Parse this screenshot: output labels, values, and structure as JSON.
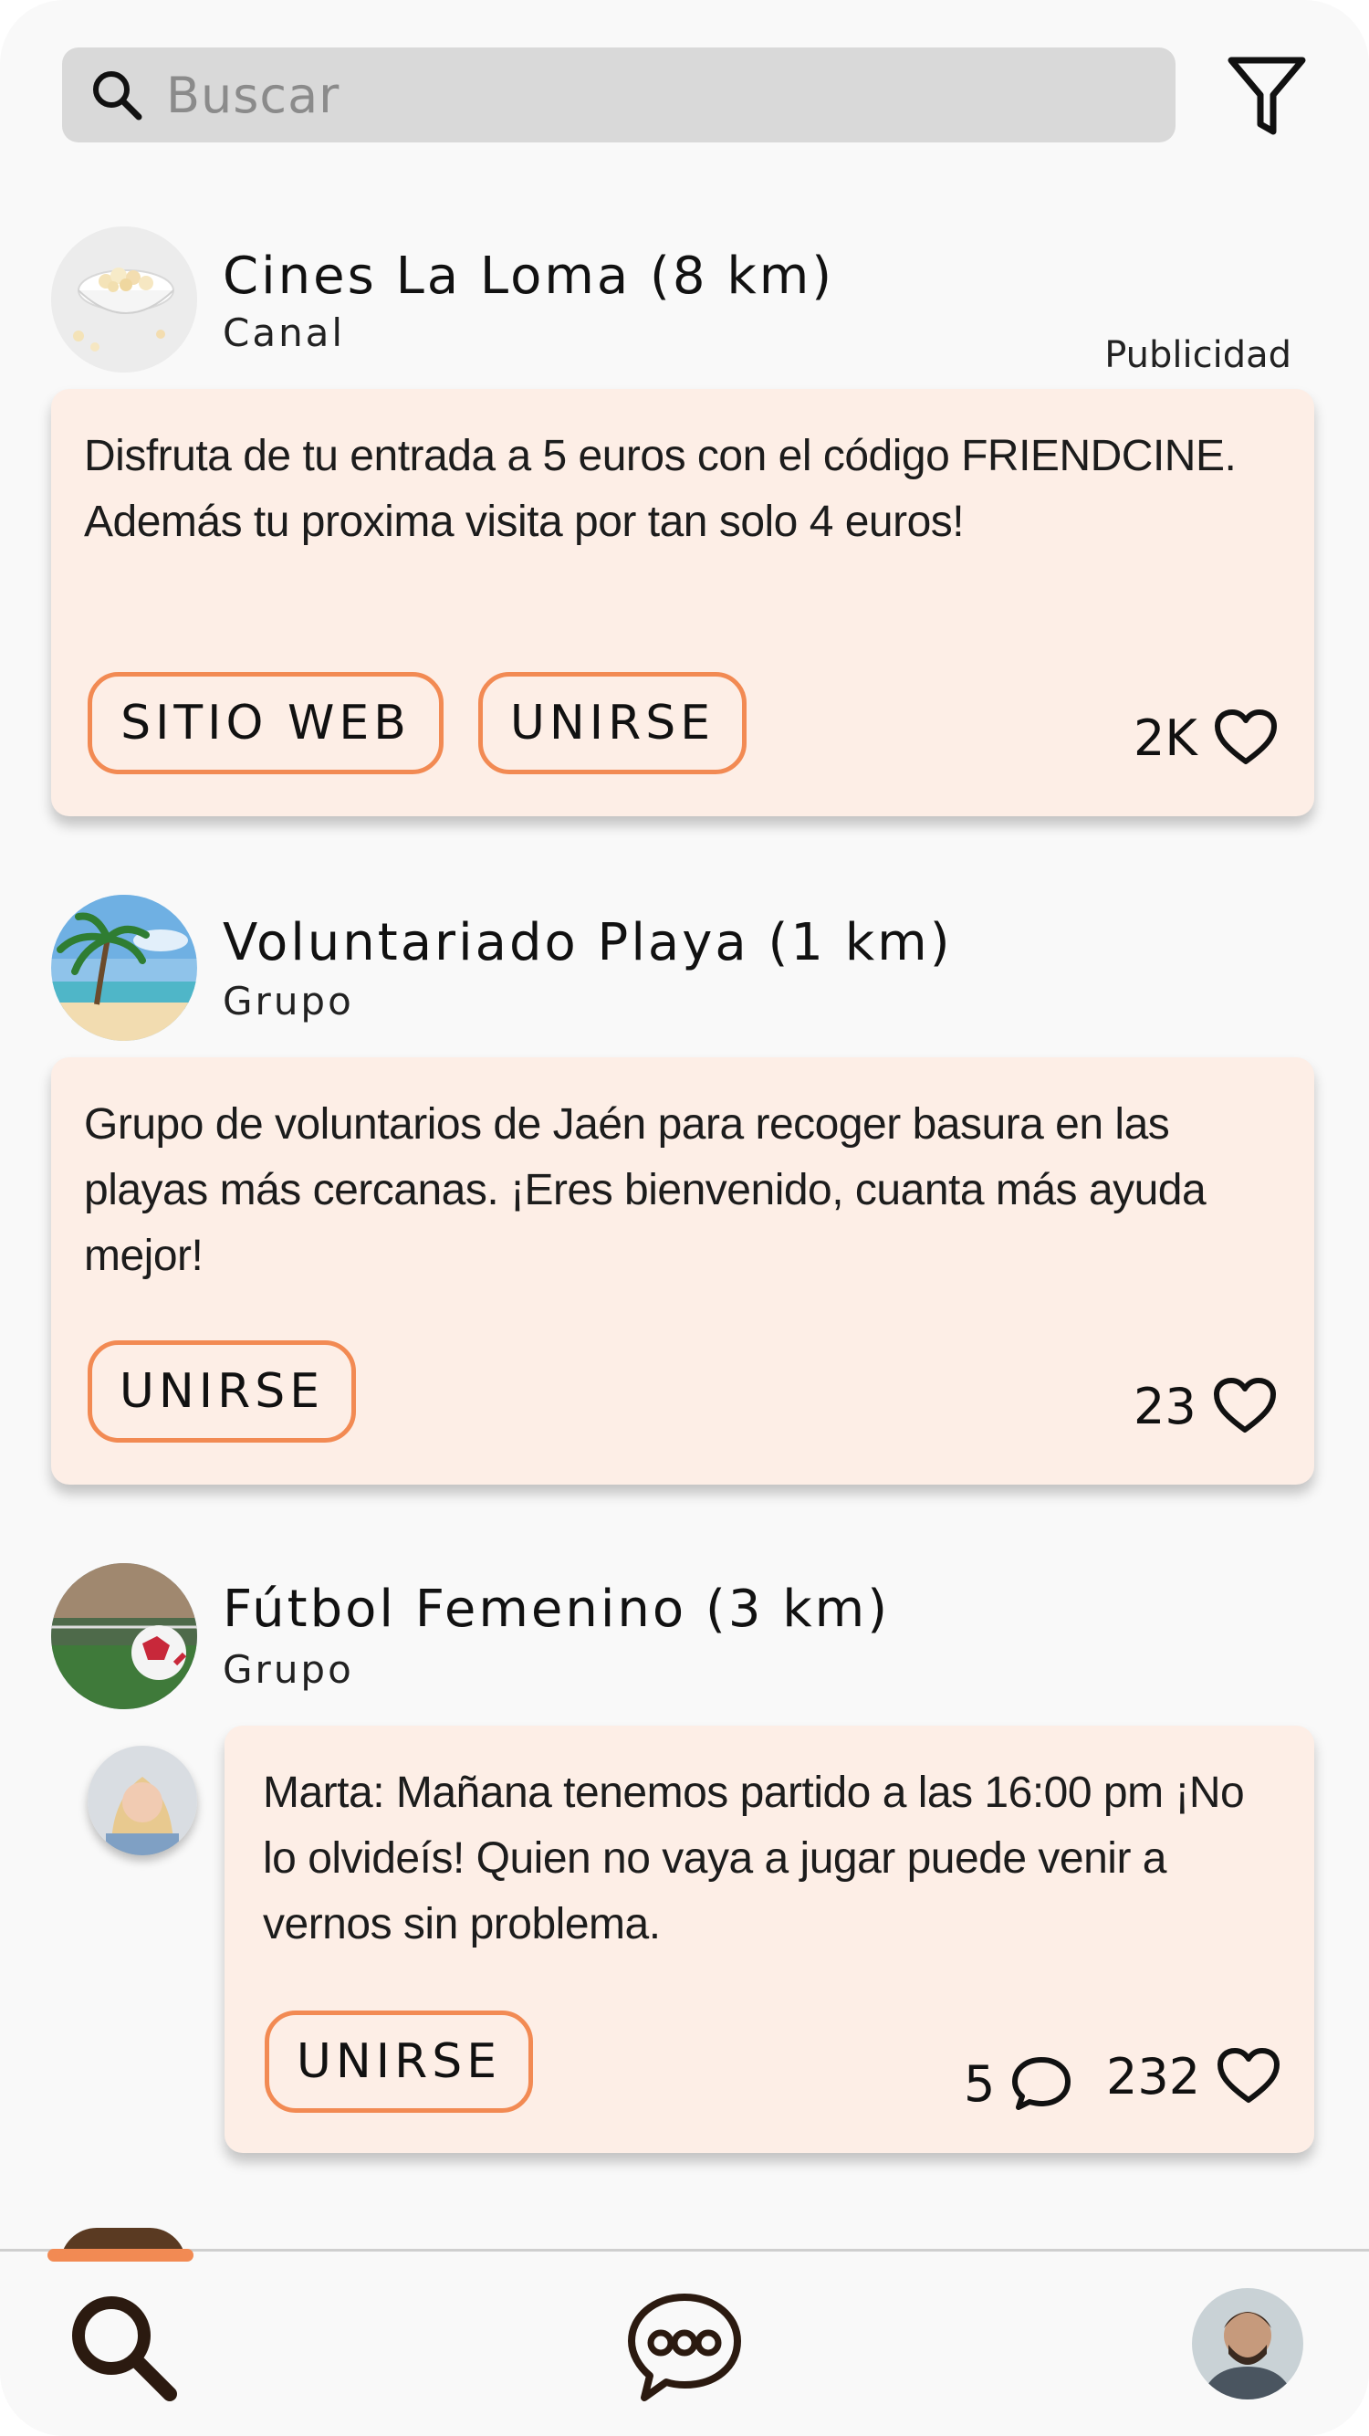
{
  "search": {
    "placeholder": "Buscar"
  },
  "feed": [
    {
      "title": "Cines La Loma (8 km)",
      "type": "Canal",
      "ad_label": "Publicidad",
      "text_lines": [
        "Disfruta de tu entrada a 5 euros con el código FRIENDCINE.",
        "Además tu proxima visita por tan solo 4 euros!"
      ],
      "buttons": [
        "SITIO WEB",
        "UNIRSE"
      ],
      "likes": "2K"
    },
    {
      "title": "Voluntariado Playa (1 km)",
      "type": "Grupo",
      "text_lines": [
        "Grupo de voluntarios de Jaén para recoger basura en las",
        "playas más cercanas. ¡Eres bienvenido, cuanta más ayuda",
        "mejor!"
      ],
      "buttons": [
        "UNIRSE"
      ],
      "likes": "23"
    },
    {
      "title": "Fútbol Femenino (3 km)",
      "type": "Grupo",
      "text_lines": [
        "Marta: Mañana tenemos partido a las 16:00 pm ¡No",
        "lo olvideís! Quien no vaya a jugar puede venir a",
        "vernos sin problema."
      ],
      "buttons": [
        "UNIRSE"
      ],
      "comments": "5",
      "likes": "232"
    }
  ],
  "nav": {
    "items": [
      "search-icon",
      "chat-icon",
      "profile-avatar"
    ]
  },
  "colors": {
    "accent": "#f28a53",
    "bubble": "#fdeee6",
    "search_bg": "#d9d9d9"
  }
}
